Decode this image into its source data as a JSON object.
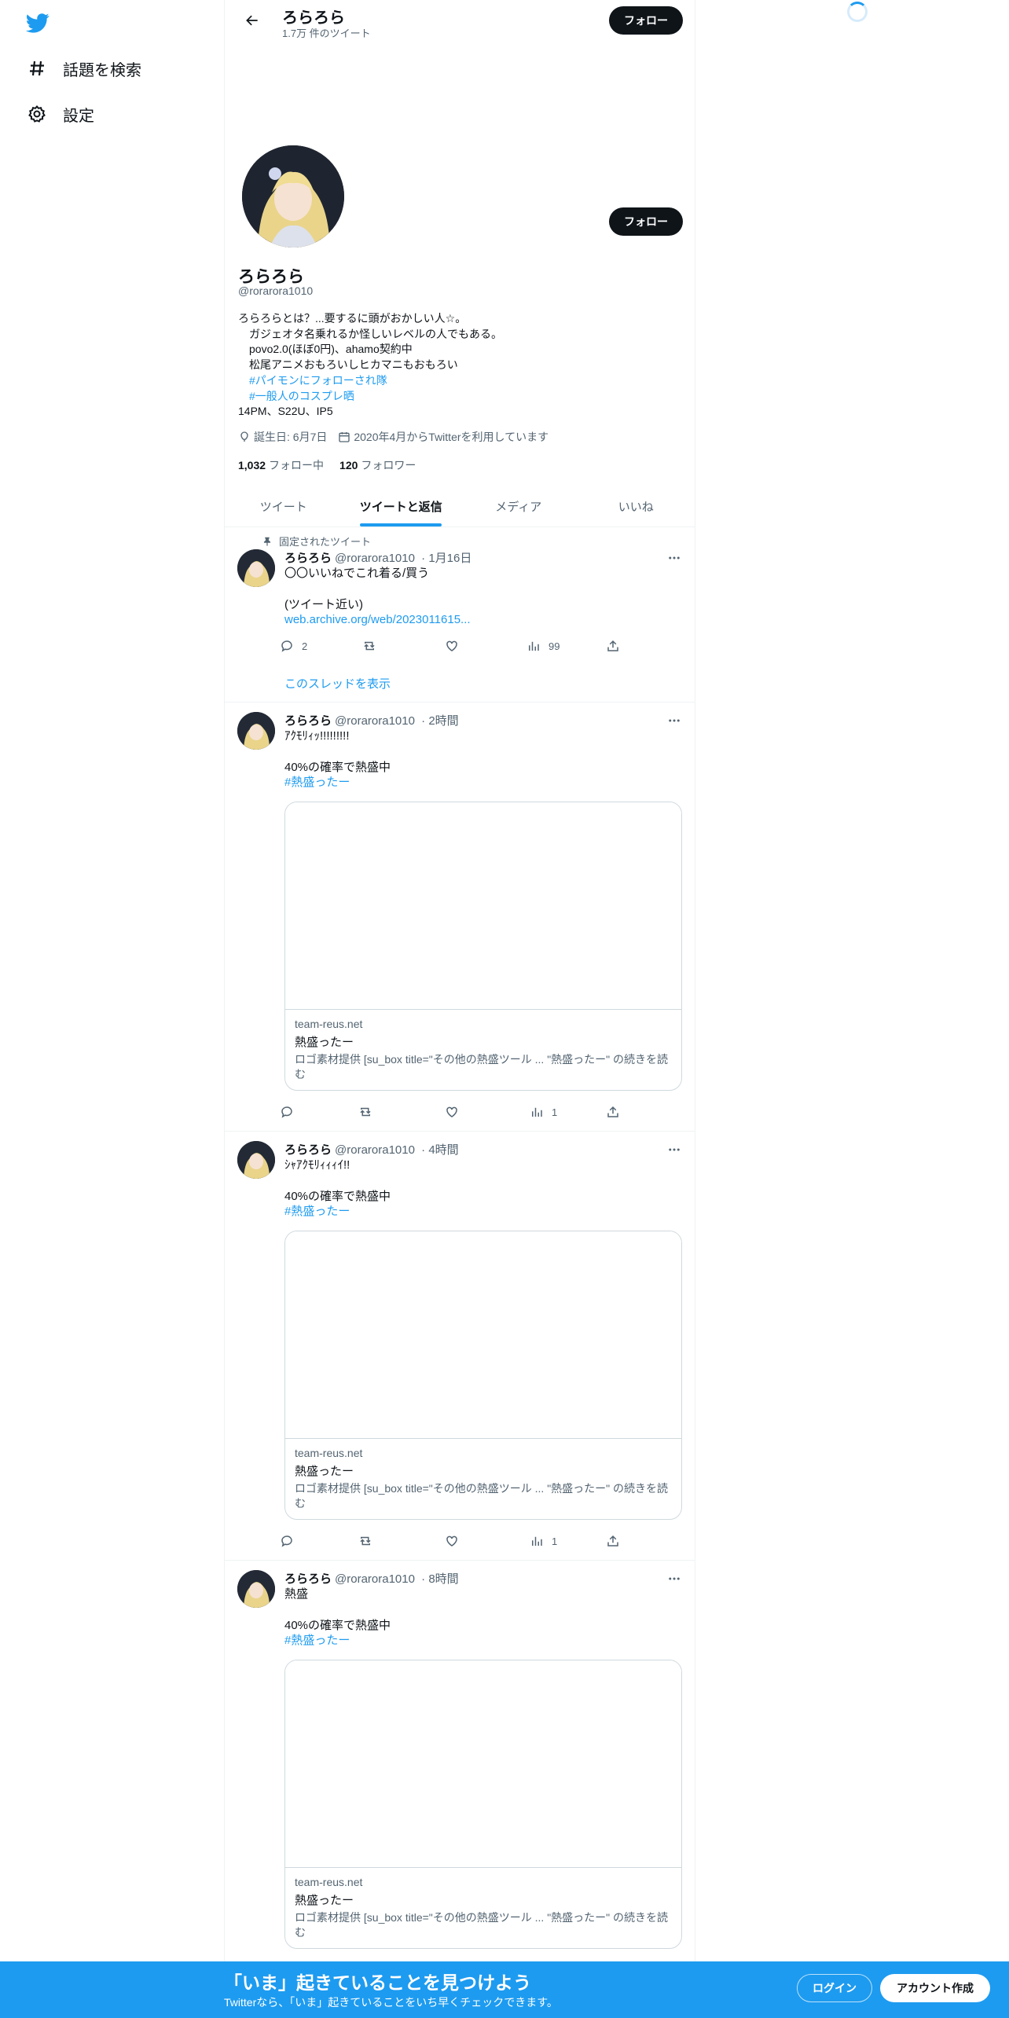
{
  "sidebar": {
    "logo_icon": "twitter-bird-icon",
    "items": [
      {
        "icon": "hashtag-icon",
        "label": "話題を検索"
      },
      {
        "icon": "gear-icon",
        "label": "設定"
      }
    ]
  },
  "header": {
    "name": "ろらろら",
    "tweet_count": "1.7万 件のツイート",
    "follow_label": "フォロー"
  },
  "profile": {
    "name": "ろらろら",
    "handle": "@rorarora1010",
    "follow_label": "フォロー",
    "bio": {
      "line1": "ろらろらとは？...要するに頭がおかしい人☆。",
      "line2": "　ガジェオタ名乗れるか怪しいレベルの人でもある。",
      "line3": "　povo2.0(ほぼ0円)、ahamo契約中",
      "line4": "　松尾アニメおもろいしヒカマニもおもろい",
      "tag1": "　#パイモンにフォローされ隊",
      "tag2": "　#一般人のコスプレ晒",
      "line7": "14PM、S22U、IP5"
    },
    "birthday": "誕生日: 6月7日",
    "joined": "2020年4月からTwitterを利用しています",
    "following_count": "1,032",
    "following_label": "フォロー中",
    "followers_count": "120",
    "followers_label": "フォロワー"
  },
  "tabs": [
    {
      "label": "ツイート",
      "active": false
    },
    {
      "label": "ツイートと返信",
      "active": true
    },
    {
      "label": "メディア",
      "active": false
    },
    {
      "label": "いいね",
      "active": false
    }
  ],
  "tweets": [
    {
      "pinned_label": "固定されたツイート",
      "name": "ろらろら",
      "handle": "@rorarora1010",
      "time": "1月16日",
      "line1": "〇〇いいねでこれ着る/買う",
      "line2": "(ツイート近い)",
      "link": "web.archive.org/web/2023011615...",
      "replies": "2",
      "views": "99",
      "thread_label": "このスレッドを表示"
    },
    {
      "name": "ろらろら",
      "handle": "@rorarora1010",
      "time": "2時間",
      "line1": "ｱｸﾓﾘｨｯ!!!!!!!!!",
      "line2": "40%の確率で熱盛中",
      "tag": "#熱盛ったー",
      "card_domain": "team-reus.net",
      "card_title": "熱盛ったー",
      "card_desc": "ロゴ素材提供 [su_box title=\"その他の熱盛ツール ... \"熱盛ったー\" の続きを読む",
      "views": "1"
    },
    {
      "name": "ろらろら",
      "handle": "@rorarora1010",
      "time": "4時間",
      "line1": "ｼｬｱｸﾓﾘｨｨｨｲ!!",
      "line2": "40%の確率で熱盛中",
      "tag": "#熱盛ったー",
      "card_domain": "team-reus.net",
      "card_title": "熱盛ったー",
      "card_desc": "ロゴ素材提供 [su_box title=\"その他の熱盛ツール ... \"熱盛ったー\" の続きを読む",
      "views": "1"
    },
    {
      "name": "ろらろら",
      "handle": "@rorarora1010",
      "time": "8時間",
      "line1": "熱盛",
      "line2": "40%の確率で熱盛中",
      "tag": "#熱盛ったー",
      "card_domain": "team-reus.net",
      "card_title": "熱盛ったー",
      "card_desc": "ロゴ素材提供 [su_box title=\"その他の熱盛ツール ... \"熱盛ったー\" の続きを読む"
    }
  ],
  "banner": {
    "title": "「いま」起きていることを見つけよう",
    "subtitle": "Twitterなら、「いま」起きていることをいち早くチェックできます。",
    "login_label": "ログイン",
    "signup_label": "アカウント作成"
  },
  "colors": {
    "accent": "#1d9bf0",
    "text": "#0f1419",
    "muted": "#536471"
  }
}
